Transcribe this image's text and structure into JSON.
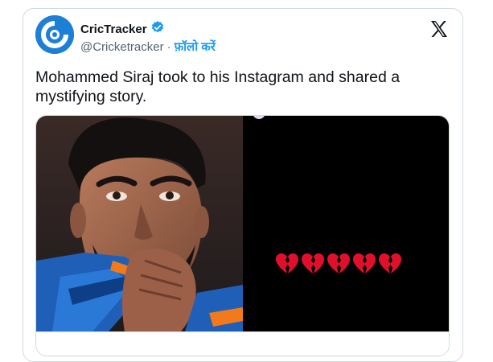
{
  "tweet": {
    "display_name": "CricTracker",
    "handle": "@Cricketracker",
    "separator": "·",
    "follow_label": "फ़ॉलो करें",
    "text": "Mohammed Siraj took to his Instagram and shared a mystifying story.",
    "verified": true
  },
  "media": {
    "heart_count": 5,
    "heart_emoji": "broken-heart",
    "heart_color": "#e0102b",
    "right_panel_color": "#000000"
  },
  "colors": {
    "follow": "#1d9bf0",
    "avatar": "#1d7fd6",
    "verified": "#1d9bf0"
  }
}
